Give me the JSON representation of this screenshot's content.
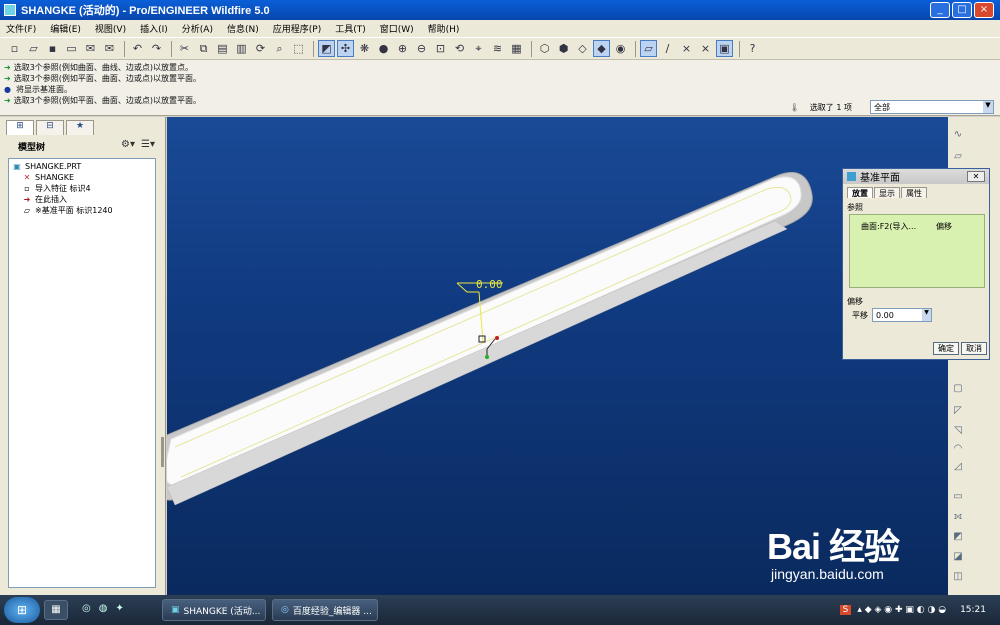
{
  "window": {
    "title": "SHANGKE (活动的) - Pro/ENGINEER Wildfire 5.0"
  },
  "menu": [
    "文件(F)",
    "编辑(E)",
    "视图(V)",
    "插入(I)",
    "分析(A)",
    "信息(N)",
    "应用程序(P)",
    "工具(T)",
    "窗口(W)",
    "帮助(H)"
  ],
  "messages": [
    {
      "icon": "arrow",
      "text": "选取3个参照(例如曲面、曲线、边或点)以放置点。"
    },
    {
      "icon": "arrow",
      "text": "选取3个参照(例如平面、曲面、边或点)以放置平面。"
    },
    {
      "icon": "dot",
      "text": "将显示基准面。"
    },
    {
      "icon": "arrow",
      "text": "选取3个参照(例如平面、曲面、边或点)以放置平面。"
    }
  ],
  "selection": {
    "status": "选取了 1 项",
    "filter": "全部"
  },
  "model_tree": {
    "header": "模型树",
    "items": [
      {
        "icon": "part-icon",
        "label": "SHANGKE.PRT"
      },
      {
        "icon": "csys-icon",
        "label": "SHANGKE"
      },
      {
        "icon": "import-icon",
        "label": "导入特征 标识4"
      },
      {
        "icon": "insert-arrow-icon",
        "label": "在此插入"
      },
      {
        "icon": "datum-plane-icon",
        "label": "※基准平面 标识1240"
      }
    ]
  },
  "graphics": {
    "dimension": "0.00"
  },
  "dialog": {
    "title": "基准平面",
    "tabs": [
      "放置",
      "显示",
      "属性"
    ],
    "references_label": "参照",
    "reference": {
      "name": "曲面:F2(导入...",
      "type": "偏移"
    },
    "offset_label": "偏移",
    "translate_label": "平移",
    "translate_value": "0.00",
    "ok": "确定",
    "cancel": "取消"
  },
  "taskbar": {
    "tasks": [
      "SHANGKE (活动...",
      "百度经验_编辑器 ..."
    ],
    "clock": "15:21"
  },
  "watermark": {
    "logo": "Bai 经验",
    "url": "jingyan.baidu.com"
  }
}
